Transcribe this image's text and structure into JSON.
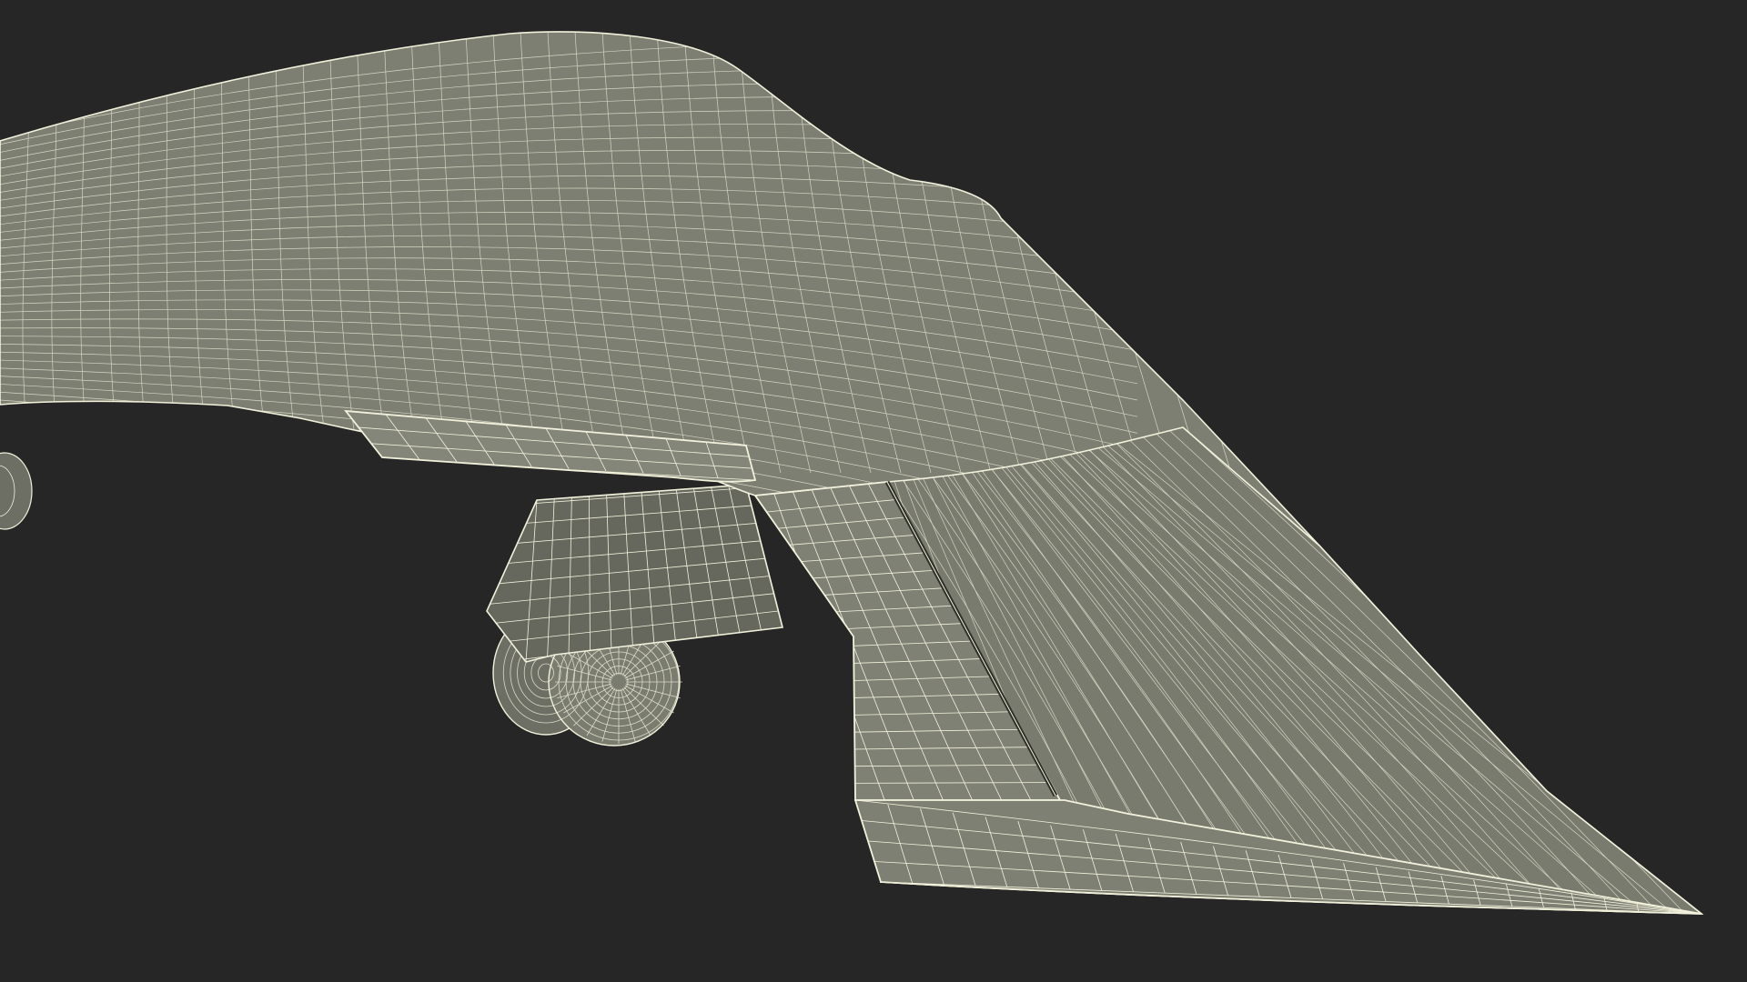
{
  "scene": {
    "background_color": "#262626",
    "surface_color": "#7e7f73",
    "surface_shadow_color": "#6a6b60",
    "wireframe_color": "#f2f2dc",
    "wire_opacity": 0.75,
    "parts": [
      "fuselage-upper-surface",
      "wing-trailing-edge-flap",
      "wing-right",
      "aileron",
      "landing-gear-fairing",
      "landing-gear-wheels",
      "left-wheel-partial"
    ]
  }
}
